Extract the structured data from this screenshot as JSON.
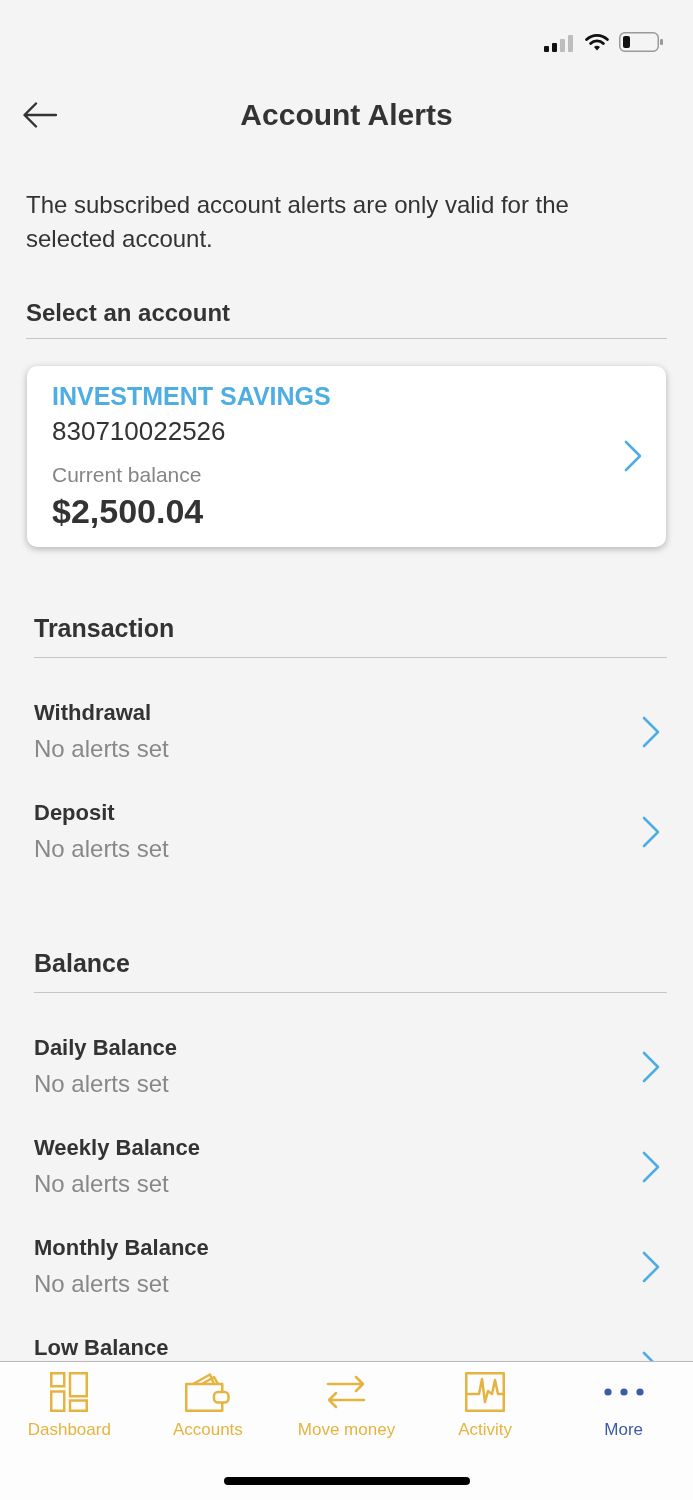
{
  "header": {
    "title": "Account Alerts"
  },
  "intro": "The subscribed account alerts are only valid for the selected account.",
  "account_picker": {
    "label": "Select an account",
    "account": {
      "name": "INVESTMENT SAVINGS",
      "number": "830710022526",
      "balance_label": "Current balance",
      "balance": "$2,500.04"
    }
  },
  "sections": [
    {
      "title": "Transaction",
      "items": [
        {
          "title": "Withdrawal",
          "status": "No alerts set"
        },
        {
          "title": "Deposit",
          "status": "No alerts set"
        }
      ]
    },
    {
      "title": "Balance",
      "items": [
        {
          "title": "Daily Balance",
          "status": "No alerts set"
        },
        {
          "title": "Weekly Balance",
          "status": "No alerts set"
        },
        {
          "title": "Monthly Balance",
          "status": "No alerts set"
        },
        {
          "title": "Low Balance"
        }
      ]
    }
  ],
  "tab_bar": [
    {
      "label": "Dashboard",
      "selected": false
    },
    {
      "label": "Accounts",
      "selected": false
    },
    {
      "label": "Move money",
      "selected": false
    },
    {
      "label": "Activity",
      "selected": false
    },
    {
      "label": "More",
      "selected": true
    }
  ]
}
